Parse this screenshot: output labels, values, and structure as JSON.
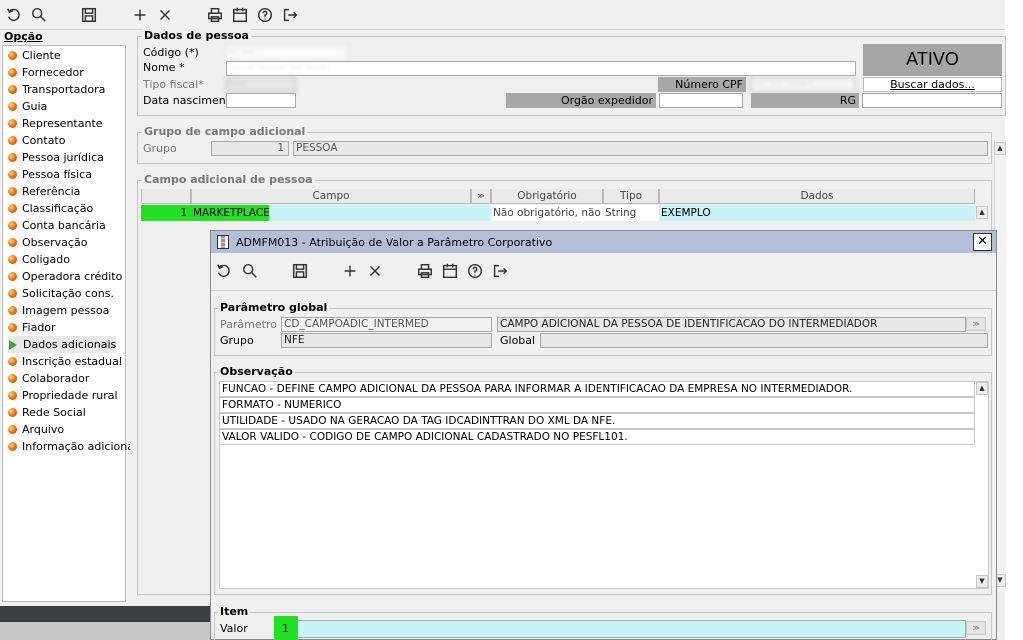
{
  "toolbar": {
    "icons": [
      "undo-icon",
      "search-icon",
      "save-icon",
      "add-icon",
      "delete-icon",
      "print-icon",
      "calendar-icon",
      "help-icon",
      "exit-icon"
    ]
  },
  "sidebar": {
    "title": "Opção",
    "items": [
      {
        "label": "Cliente"
      },
      {
        "label": "Fornecedor"
      },
      {
        "label": "Transportadora"
      },
      {
        "label": "Guia"
      },
      {
        "label": "Representante"
      },
      {
        "label": "Contato"
      },
      {
        "label": "Pessoa jurídica"
      },
      {
        "label": "Pessoa física"
      },
      {
        "label": "Referência"
      },
      {
        "label": "Classificação"
      },
      {
        "label": "Conta bancária"
      },
      {
        "label": "Observação"
      },
      {
        "label": "Coligado"
      },
      {
        "label": "Operadora crédito"
      },
      {
        "label": "Solicitação cons."
      },
      {
        "label": "Imagem pessoa"
      },
      {
        "label": "Fiador"
      },
      {
        "label": "Dados adicionais",
        "active": true
      },
      {
        "label": "Inscrição estadual"
      },
      {
        "label": "Colaborador"
      },
      {
        "label": "Propriedade rural"
      },
      {
        "label": "Rede Social"
      },
      {
        "label": "Arquivo"
      },
      {
        "label": "Informação adicional"
      }
    ]
  },
  "pessoa": {
    "section_title": "Dados de pessoa",
    "codigo_label": "Código (*)",
    "nome_label": "Nome *",
    "tipo_fiscal_label": "Tipo fiscal*",
    "data_nasc_label": "Data nascimento",
    "codigo_value": "·· ···",
    "nome_value": "··· ·· ······ ··· ·····",
    "tipo_fiscal_value": "····",
    "cpf_value": "··· ··· ···-··",
    "cpf_label": "Número CPF",
    "orgao_label": "Orgão expedidor",
    "rg_label": "RG",
    "status": "ATIVO",
    "buscar_label": "Buscar dados..."
  },
  "grupo": {
    "section_title": "Grupo de campo adicional",
    "grupo_label": "Grupo",
    "grupo_num": "1",
    "grupo_name": "PESSOA"
  },
  "campo": {
    "section_title": "Campo adicional de pessoa",
    "headers": [
      "Campo",
      "Obrigatório",
      "Tipo",
      "Dados"
    ],
    "row": {
      "num": "1",
      "campo": "MARKETPLACE",
      "obrigatorio": "Não obrigatório, não a",
      "tipo": "String",
      "dados": "EXEMPLO"
    }
  },
  "dialog": {
    "title": "ADMFM013 - Atribuição de Valor a Parâmetro Corporativo",
    "param_section": "Parâmetro global",
    "parametro_label": "Parâmetro",
    "parametro_value": "CD_CAMPOADIC_INTERMED",
    "parametro_desc": "CAMPO ADICIONAL DA PESSOA DE IDENTIFICACAO DO INTERMEDIADOR",
    "grupo_label": "Grupo",
    "grupo_value": "NFE",
    "global_label": "Global",
    "obs_section": "Observação",
    "obs_lines": [
      "FUNCAO - DEFINE CAMPO ADICIONAL DA PESSOA PARA INFORMAR A IDENTIFICACAO DA EMPRESA NO INTERMEDIADOR.",
      "FORMATO - NUMERICO",
      "UTILIDADE - USADO NA GERACAO DA TAG IDCADINTTRAN DO XML DA NFE.",
      "VALOR VALIDO - CODIGO DE CAMPO ADICIONAL CADASTRADO NO PESFL101."
    ],
    "item_section": "Item",
    "valor_label": "Valor",
    "valor_value": "1"
  },
  "colors": {
    "accent_green": "#22e022",
    "cyan_field": "#c8f4f6",
    "dialog_title_bg": "#b3bfd9"
  }
}
